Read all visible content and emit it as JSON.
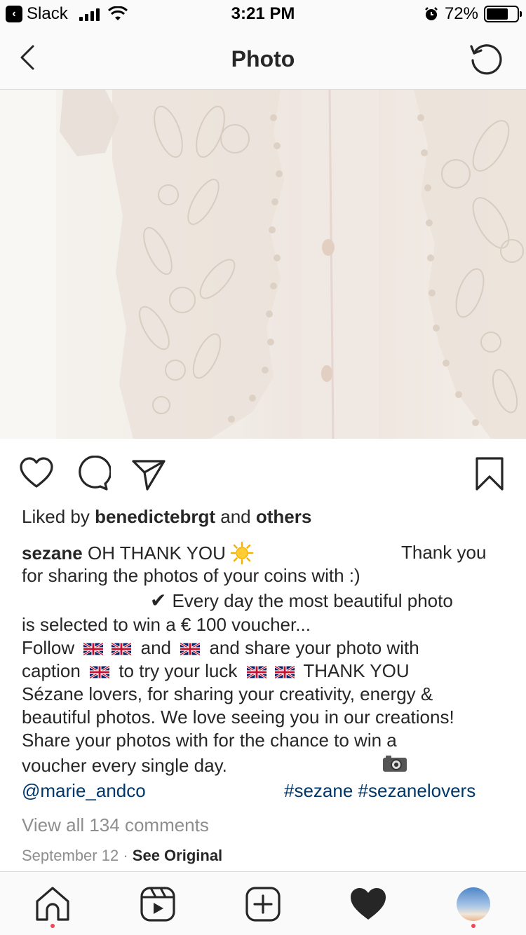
{
  "status_bar": {
    "back_app": "Slack",
    "time": "3:21 PM",
    "battery_percent": "72%",
    "battery_level": 0.72
  },
  "header": {
    "title": "Photo"
  },
  "post": {
    "likes_prefix": "Liked by",
    "liked_by_user": "benedictebrgt",
    "likes_and": "and",
    "likes_others": "others",
    "caption": {
      "username": "sezane",
      "line1_text": "OH THANK YOU",
      "line1_right": "Thank you",
      "line2": "for sharing the photos of your coins with :)",
      "line3": "Every day the most beautiful photo",
      "line4": "is selected to win a € 100 voucher...",
      "line5_a": "Follow",
      "line5_b": "and",
      "line5_c": "and share your photo with",
      "line6_a": "caption",
      "line6_b": "to try your luck",
      "line6_c": "THANK YOU",
      "line7": "Sézane lovers, for sharing your creativity, energy &",
      "line8": "beautiful photos. We love seeing you in our creations!",
      "line9": "Share your photos with for the chance to win a",
      "line10": "voucher every single day.",
      "mention": "@marie_andco",
      "hashtag1": "#sezane",
      "hashtag2": "#sezanelovers"
    },
    "view_all_comments": "View all 134 comments",
    "date": "September 12",
    "separator": "·",
    "see_original": "See Original"
  },
  "colors": {
    "link": "#00376b",
    "muted": "#8e8e8e",
    "notification_dot": "#ed4956"
  }
}
